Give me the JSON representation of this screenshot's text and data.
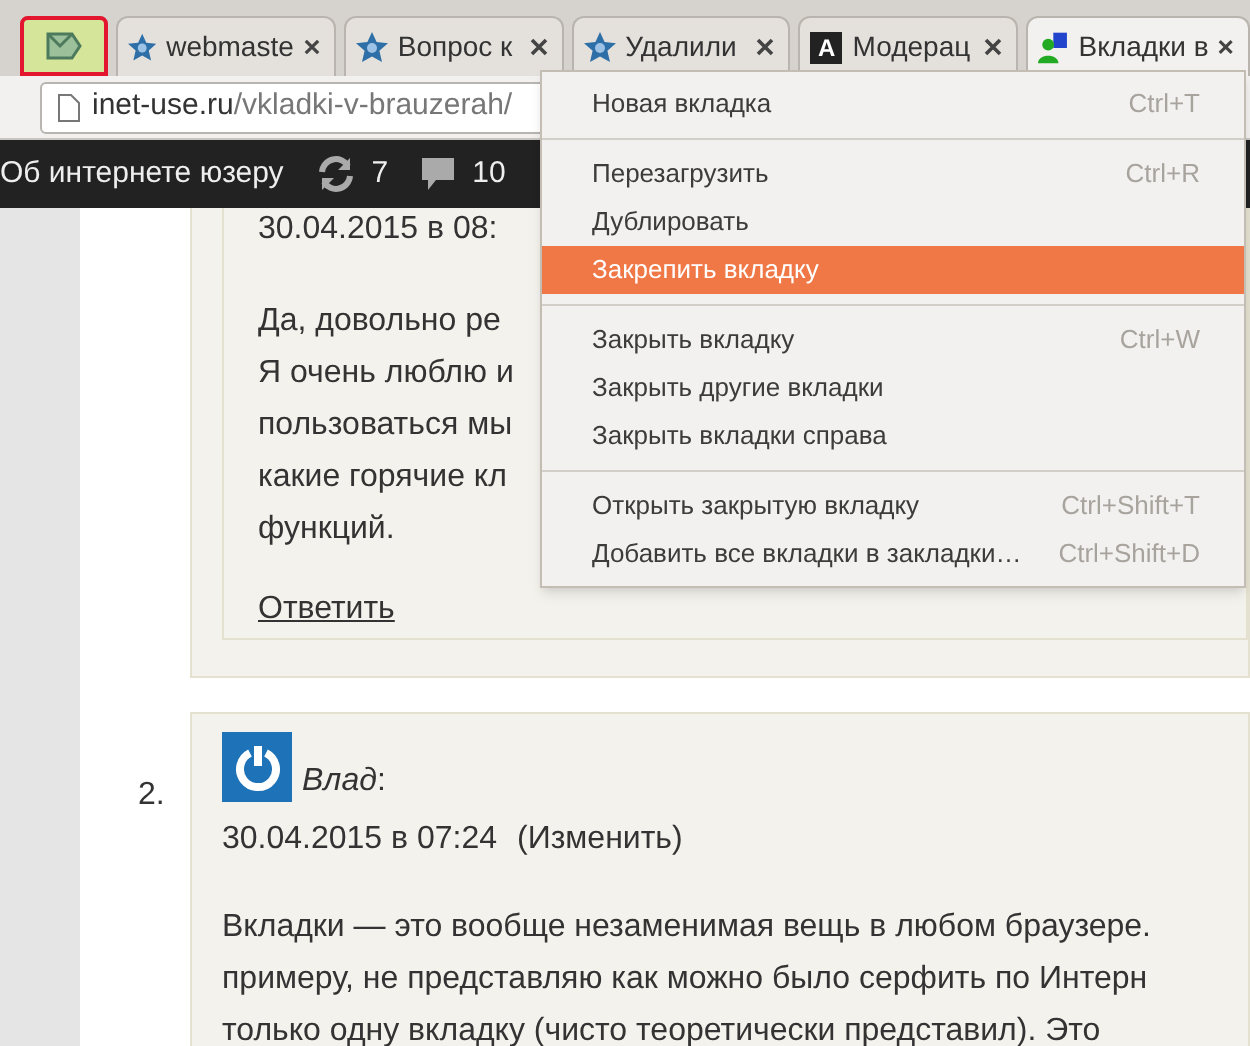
{
  "tabs": [
    {
      "kind": "pinned",
      "selected": false,
      "highlighted": true
    },
    {
      "kind": "star",
      "title": "webmaste",
      "selected": false,
      "highlighted": false
    },
    {
      "kind": "star",
      "title": "Вопрос к",
      "selected": false,
      "highlighted": false
    },
    {
      "kind": "star",
      "title": "Удалили",
      "selected": false,
      "highlighted": false
    },
    {
      "kind": "letter",
      "letter": "A",
      "title": "Модерац",
      "selected": false,
      "highlighted": false
    },
    {
      "kind": "user",
      "title": "Вкладки в",
      "selected": true,
      "highlighted": false
    }
  ],
  "address": {
    "domain": "inet-use.ru",
    "path": "/vkladki-v-brauzerah/"
  },
  "admin_bar": {
    "site": "Об интернете юзеру",
    "updates": "7",
    "comments": "10"
  },
  "comments": [
    {
      "date": "30.04.2015 в 08:",
      "lines": [
        "Да, довольно ре",
        "Я очень люблю и",
        "пользоваться мы",
        "какие горячие кл",
        "функций."
      ],
      "reply": "Ответить"
    },
    {
      "number": "2.",
      "author": "*Влад*:",
      "date": "30.04.2015 в 07:24",
      "edit": "(Изменить)",
      "lines": [
        "Вкладки — это вообще незаменимая вещь в любом браузере.",
        "примеру, не представляю как можно было серфить по Интерн",
        "только одну вкладку (чисто теоретически представил). Это"
      ]
    }
  ],
  "menu": {
    "groups": [
      [
        {
          "label": "Новая вкладка",
          "shortcut": "Ctrl+T",
          "selected": false
        }
      ],
      [
        {
          "label": "Перезагрузить",
          "shortcut": "Ctrl+R",
          "selected": false
        },
        {
          "label": "Дублировать",
          "selected": false
        },
        {
          "label": "Закрепить вкладку",
          "selected": true
        }
      ],
      [
        {
          "label": "Закрыть вкладку",
          "shortcut": "Ctrl+W",
          "selected": false
        },
        {
          "label": "Закрыть другие вкладки",
          "selected": false
        },
        {
          "label": "Закрыть вкладки справа",
          "selected": false
        }
      ],
      [
        {
          "label": "Открыть закрытую вкладку",
          "shortcut": "Ctrl+Shift+T",
          "selected": false
        },
        {
          "label": "Добавить все вкладки в закладки…",
          "shortcut": "Ctrl+Shift+D",
          "selected": false
        }
      ]
    ]
  }
}
